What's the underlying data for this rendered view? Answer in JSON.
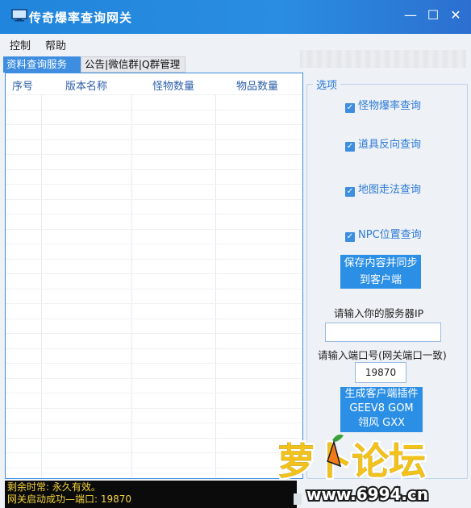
{
  "window": {
    "title": "传奇爆率查询网关",
    "controls": {
      "minimize": "—",
      "maximize": "☐",
      "close": "✕"
    }
  },
  "menu": {
    "items": [
      "控制",
      "帮助"
    ]
  },
  "tabs": [
    {
      "label": "资料查询服务",
      "active": true
    },
    {
      "label": "公告|微信群|Q群管理",
      "active": false
    }
  ],
  "table": {
    "columns": [
      "序号",
      "版本名称",
      "怪物数量",
      "物品数量"
    ],
    "rows": []
  },
  "options": {
    "legend": "选项",
    "checkboxes": [
      {
        "label": "怪物爆率查询",
        "checked": true
      },
      {
        "label": "道具反向查询",
        "checked": true
      },
      {
        "label": "地图走法查询",
        "checked": true
      },
      {
        "label": "NPC位置查询",
        "checked": true
      }
    ],
    "save_button": {
      "line1": "保存内容并同步",
      "line2": "到客户端"
    },
    "server_ip_label": "请输入你的服务器IP",
    "server_ip_value": "",
    "port_label": "请输入端口号(网关端口一致)",
    "port_value": "19870",
    "generate_button": {
      "line1": "生成客户端插件",
      "line2": "GEEV8 GOM",
      "line3": "翎风 GXX"
    }
  },
  "console": {
    "line1": "剩余时常: 永久有效。",
    "line2": "网关启动成功—端口:  19870"
  },
  "watermark": {
    "brand": "萝卜论坛",
    "url": "www.6994.cn"
  },
  "colors": {
    "accent": "#2b8fe6",
    "titlebar": "#1e7fd8",
    "console_text": "#f2d23b"
  }
}
